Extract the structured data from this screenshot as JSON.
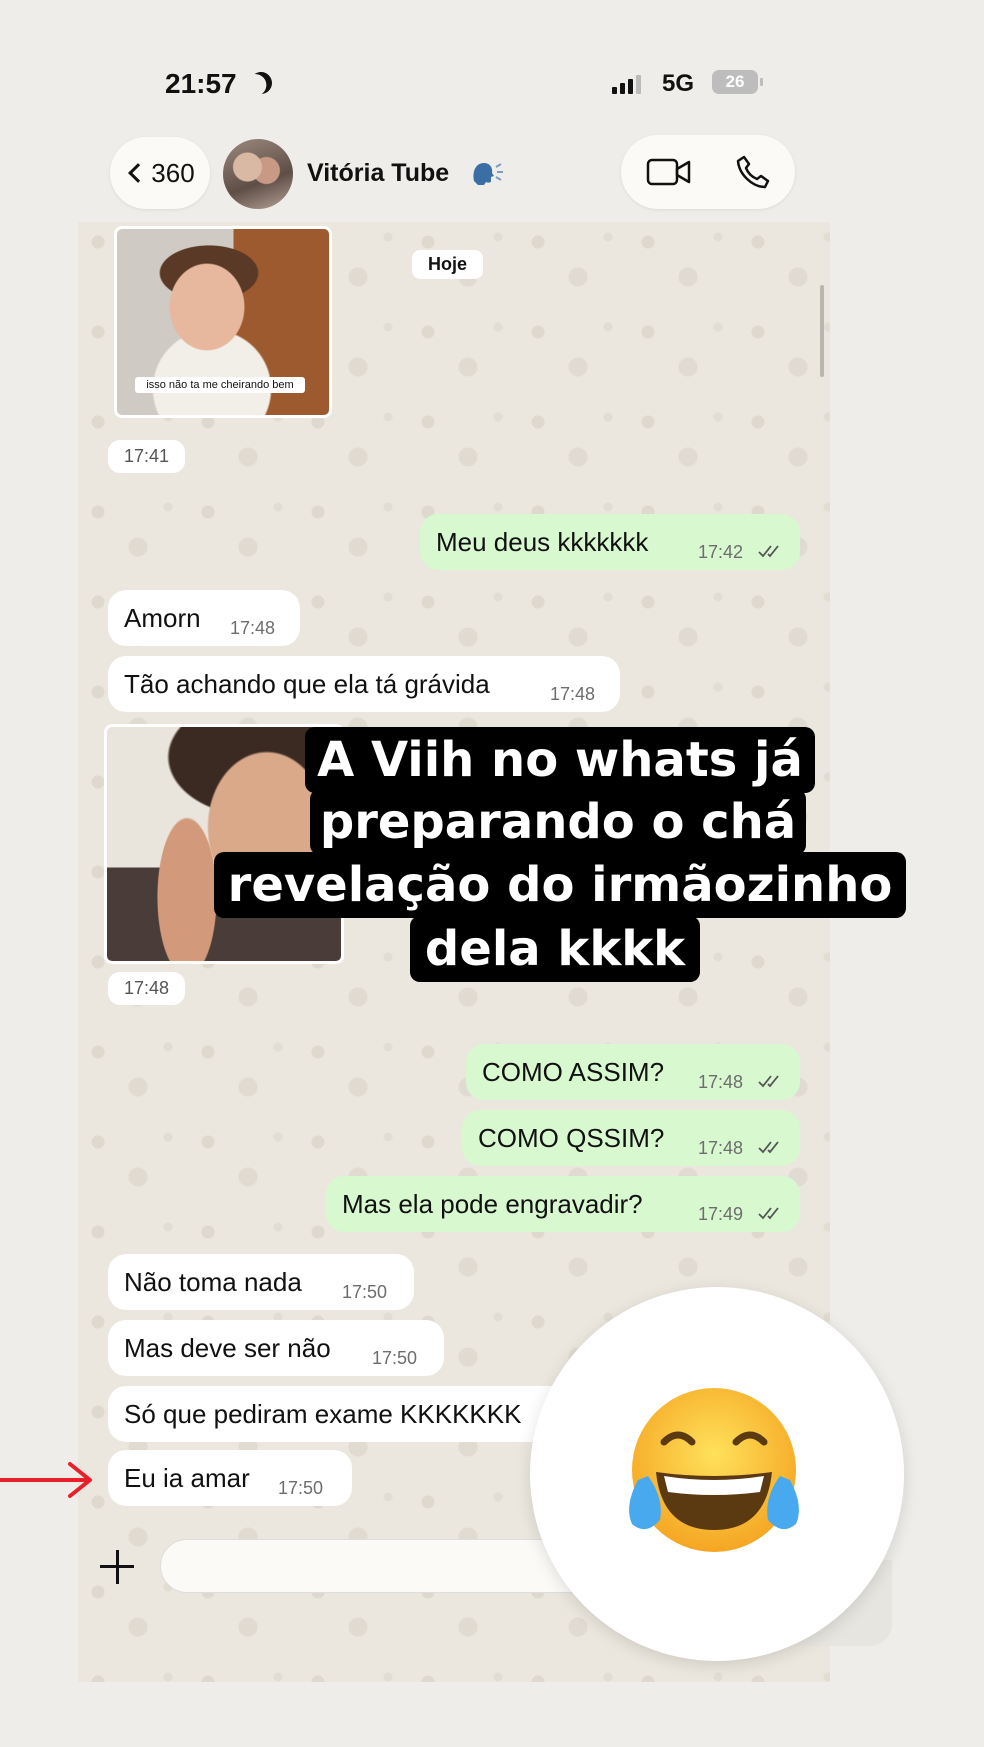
{
  "status_bar": {
    "time": "21:57",
    "network": "5G",
    "battery": "26"
  },
  "header": {
    "back_count": "360",
    "contact_name": "Vitória Tube"
  },
  "chat": {
    "date_chip": "Hoje",
    "image1": {
      "caption": "isso não ta me cheirando bem",
      "time": "17:41"
    },
    "image2": {
      "time": "17:48"
    },
    "messages": [
      {
        "dir": "out",
        "text": "Meu deus kkkkkkk",
        "time": "17:42"
      },
      {
        "dir": "in",
        "text": "Amorn",
        "time": "17:48"
      },
      {
        "dir": "in",
        "text": "Tão achando que ela tá grávida",
        "time": "17:48"
      },
      {
        "dir": "out",
        "text": "COMO ASSIM?",
        "time": "17:48"
      },
      {
        "dir": "out",
        "text": "COMO QSSIM?",
        "time": "17:48"
      },
      {
        "dir": "out",
        "text": "Mas ela pode engravadir?",
        "time": "17:49"
      },
      {
        "dir": "in",
        "text": "Não toma nada",
        "time": "17:50"
      },
      {
        "dir": "in",
        "text": "Mas deve ser não",
        "time": "17:50"
      },
      {
        "dir": "in",
        "text": "Só que pediram exame KKKKKKK",
        "time": ""
      },
      {
        "dir": "in",
        "text": "Eu ia amar",
        "time": "17:50"
      }
    ]
  },
  "overlay_caption": {
    "lines": [
      "A Viih no whats já",
      "preparando o chá",
      "revelação do irmãozinho",
      "dela kkkk"
    ]
  },
  "reaction": {
    "emoji": "face-with-tears-of-joy"
  },
  "colors": {
    "outgoing_bubble": "#d8f8d0",
    "incoming_bubble": "#ffffff",
    "arrow": "#e8202a"
  }
}
